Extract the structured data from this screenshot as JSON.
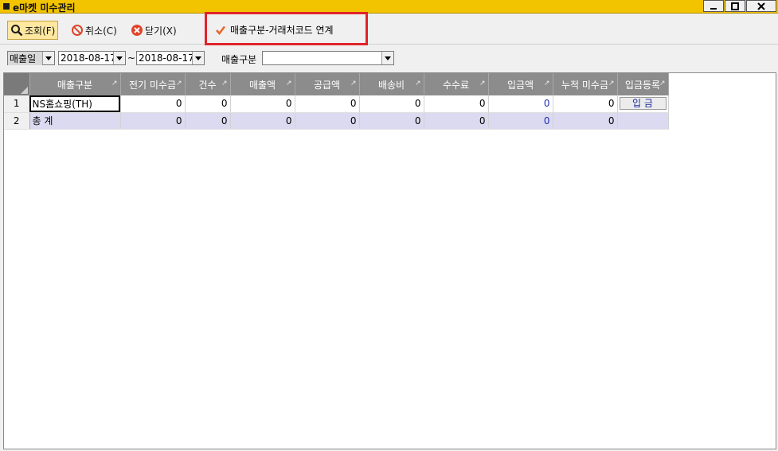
{
  "window": {
    "title": "e마켓 미수관리"
  },
  "toolbar": {
    "search_label": "조회(F)",
    "cancel_label": "취소(C)",
    "close_label": "닫기(X)",
    "link_label": "매출구분-거래처코드 연계"
  },
  "filters": {
    "date_type": "매출일",
    "date_from": "2018-08-17",
    "date_to": "2018-08-17",
    "sales_type_label": "매출구분",
    "sales_type_value": ""
  },
  "table": {
    "columns": [
      "매출구분",
      "전기 미수금",
      "건수",
      "매출액",
      "공급액",
      "배송비",
      "수수료",
      "입금액",
      "누적 미수금",
      "입금등록"
    ],
    "rows": [
      {
        "num": "1",
        "type": "NS홈쇼핑(TH)",
        "prev": "0",
        "count": "0",
        "sales": "0",
        "supply": "0",
        "shipping": "0",
        "fee": "0",
        "deposit": "0",
        "cumulative": "0",
        "action": "입 금"
      },
      {
        "num": "2",
        "type": "총 계",
        "prev": "0",
        "count": "0",
        "sales": "0",
        "supply": "0",
        "shipping": "0",
        "fee": "0",
        "deposit": "0",
        "cumulative": "0",
        "action": ""
      }
    ]
  },
  "colors": {
    "titlebar": "#f2c400",
    "highlight_box": "#e0232a",
    "header_bg": "#8c8c8c",
    "total_row": "#dcdaf0"
  }
}
